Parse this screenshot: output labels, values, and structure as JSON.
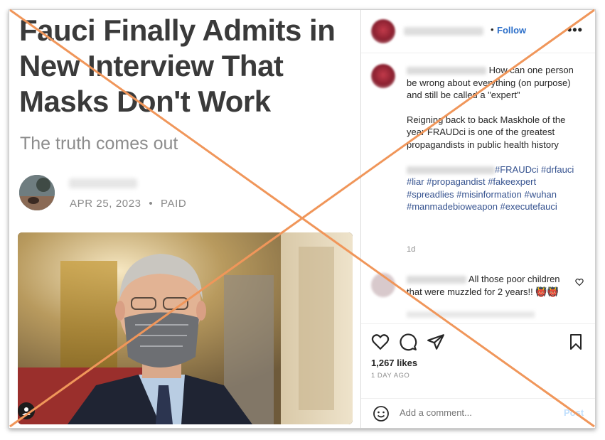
{
  "article": {
    "headline": "Fauci Finally Admits in New Interview That Masks Don't Work",
    "subtitle": "The truth comes out",
    "date": "APR 25, 2023",
    "separator": "•",
    "access": "PAID"
  },
  "post": {
    "follow_separator": "•",
    "follow_label": "Follow",
    "more_glyph": "•••",
    "caption_line1": "How can one person be wrong about everything (on purpose) and still be called a \"expert\"",
    "caption_line2": "Reigning back to back Maskhole of the year FRAUDci is one of the greatest propagandists in public health history",
    "hashtags_first": "#FRAUDci",
    "hashtags_rest": "#drfauci #liar #propagandist #fakeexpert #spreadlies #misinformation #wuhan #manmadebioweapon #executefauci",
    "age": "1d",
    "comment_text": "All those poor children that were muzzled for 2 years!!",
    "comment_emoji": "👹👹",
    "likes": "1,267 likes",
    "time_ago": "1 DAY AGO",
    "comment_placeholder": "Add a comment...",
    "post_button": "Post"
  },
  "colors": {
    "follow_blue": "#2c6fc9",
    "hashtag_blue": "#35528f",
    "cross_orange": "#f0965a",
    "headline_gray": "#3a3a3a"
  },
  "icons": [
    "person-icon",
    "more-icon",
    "heart-icon",
    "comment-icon",
    "share-icon",
    "bookmark-icon",
    "emoji-icon"
  ]
}
